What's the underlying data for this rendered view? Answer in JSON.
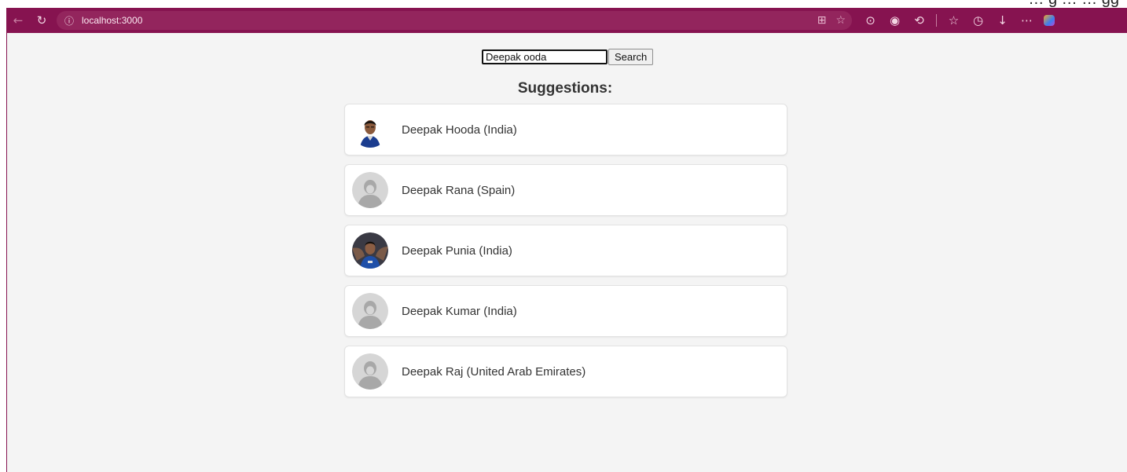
{
  "browser": {
    "url": "localhost:3000",
    "top_strip_text": "… g … … gg"
  },
  "search": {
    "value": "Deepak ooda",
    "button_label": "Search"
  },
  "heading": "Suggestions:",
  "suggestions": [
    {
      "label": "Deepak Hooda (India)",
      "avatar": "photo-hooda"
    },
    {
      "label": "Deepak Rana (Spain)",
      "avatar": "placeholder"
    },
    {
      "label": "Deepak Punia (India)",
      "avatar": "photo-punia"
    },
    {
      "label": "Deepak Kumar (India)",
      "avatar": "placeholder"
    },
    {
      "label": "Deepak Raj (United Arab Emirates)",
      "avatar": "placeholder"
    }
  ],
  "colors": {
    "toolbar": "#861350",
    "page_background": "#f4f4f4",
    "card_background": "#ffffff"
  }
}
